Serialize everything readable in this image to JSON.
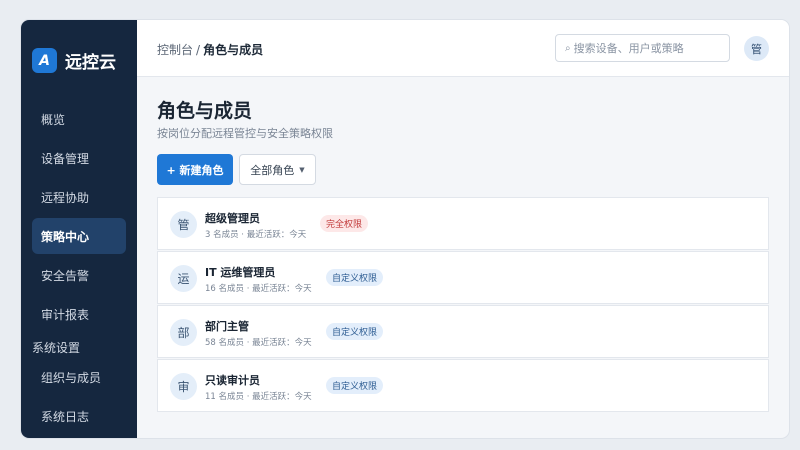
{
  "app": {
    "logo_letter": "A",
    "name": "远控云"
  },
  "sidebar": {
    "items": [
      {
        "label": "概览",
        "active": false
      },
      {
        "label": "设备管理",
        "active": false
      },
      {
        "label": "远程协助",
        "active": false
      },
      {
        "label": "策略中心",
        "active": true
      },
      {
        "label": "安全告警",
        "active": false
      },
      {
        "label": "审计报表",
        "active": false
      }
    ],
    "section_label": "系统设置",
    "sub_items": [
      {
        "label": "组织与成员"
      },
      {
        "label": "系统日志"
      }
    ]
  },
  "header": {
    "breadcrumb": {
      "root": "控制台",
      "separator": "/",
      "current": "角色与成员"
    },
    "search": {
      "placeholder": "搜索设备、用户或策略",
      "icon": "search-icon"
    },
    "avatar_text": "管"
  },
  "page": {
    "title": "角色与成员",
    "subtitle": "按岗位分配远程管控与安全策略权限",
    "primary_button": "+ 新建角色",
    "filter": {
      "selected": "全部角色",
      "icon": "caret-down-icon"
    }
  },
  "roles": [
    {
      "icon_char": "管",
      "name": "超级管理员",
      "meta": "3 名成员 · 最近活跃：今天",
      "badge": "完全权限",
      "badge_type": "full"
    },
    {
      "icon_char": "运",
      "name": "IT 运维管理员",
      "meta": "16 名成员 · 最近活跃：今天",
      "badge": "自定义权限",
      "badge_type": "custom"
    },
    {
      "icon_char": "部",
      "name": "部门主管",
      "meta": "58 名成员 · 最近活跃：今天",
      "badge": "自定义权限",
      "badge_type": "custom"
    },
    {
      "icon_char": "审",
      "name": "只读审计员",
      "meta": "11 名成员 · 最近活跃：今天",
      "badge": "自定义权限",
      "badge_type": "custom"
    }
  ],
  "colors": {
    "sidebar_bg": "#15273f",
    "accent": "#1f78d6",
    "danger_badge": "#c23a3a",
    "custom_badge": "#2f5e93"
  }
}
